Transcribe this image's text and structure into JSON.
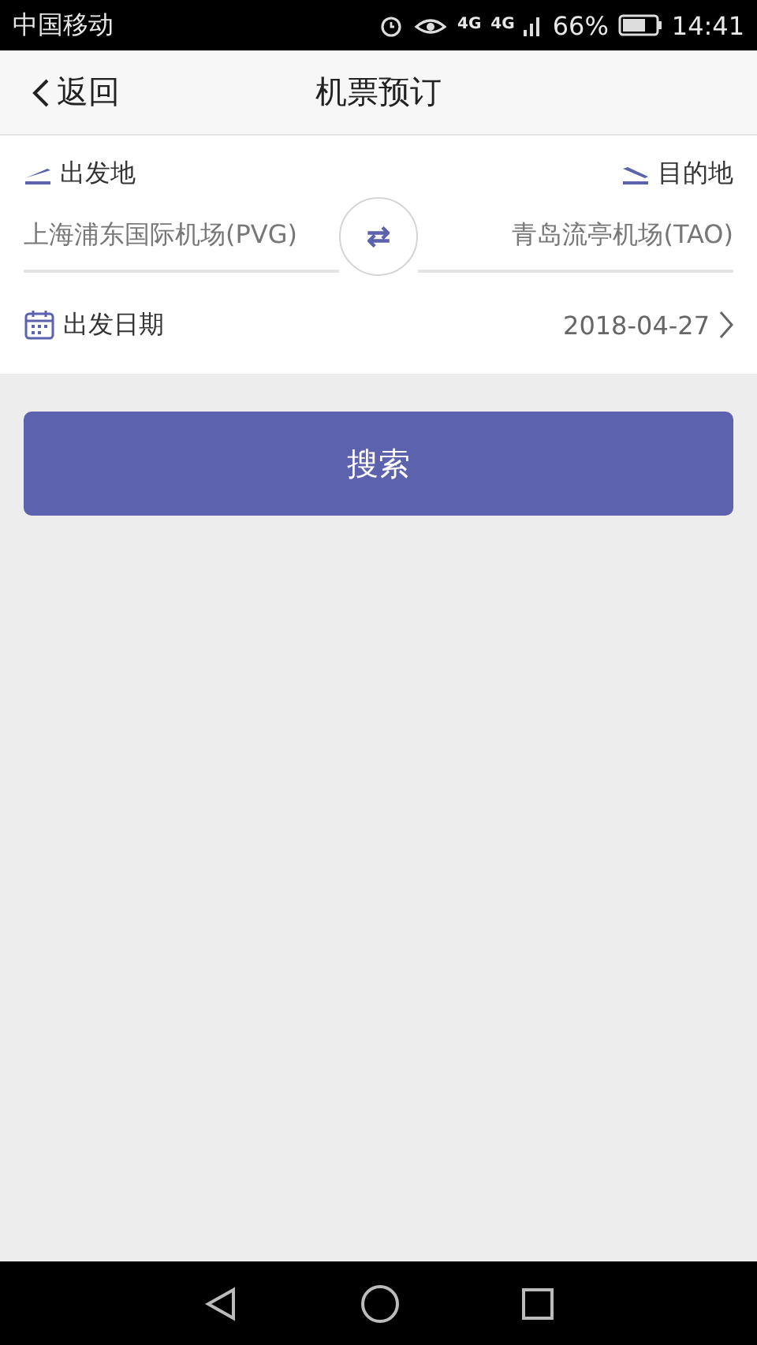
{
  "status_bar": {
    "carrier": "中国移动",
    "network_1": "4G",
    "network_2": "4G",
    "battery": "66%",
    "time": "14:41"
  },
  "header": {
    "back": "返回",
    "title": "机票预订"
  },
  "form": {
    "departure": {
      "label": "出发地",
      "value": "上海浦东国际机场(PVG)"
    },
    "arrival": {
      "label": "目的地",
      "value": "青岛流亭机场(TAO)"
    },
    "swap": "⇄",
    "date": {
      "label": "出发日期",
      "value": "2018-04-27"
    }
  },
  "search_button": "搜索"
}
